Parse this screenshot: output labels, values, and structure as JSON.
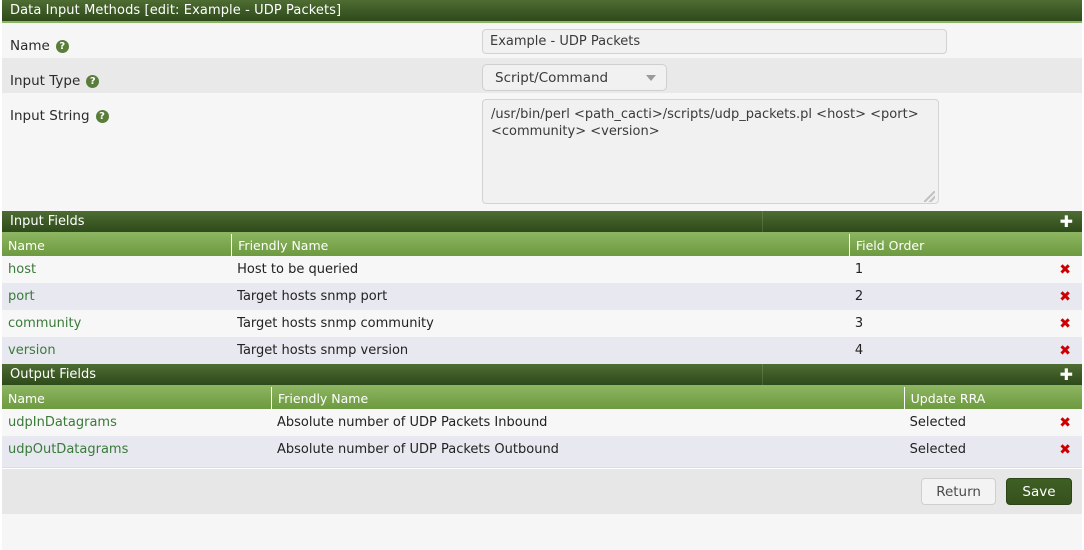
{
  "window": {
    "title": "Data Input Methods [edit: Example - UDP Packets]"
  },
  "colors": {
    "header_dark_green": "#3f5c27",
    "header_light_green": "#7aa54d",
    "accent_border": "#8ab661",
    "link_green": "#3a7a3a",
    "delete_red": "#cc0000",
    "save_button": "#35511e"
  },
  "form": {
    "name": {
      "label": "Name",
      "help_icon": "help-icon",
      "value": "Example - UDP Packets",
      "placeholder": ""
    },
    "input_type": {
      "label": "Input Type",
      "help_icon": "help-icon",
      "value": "Script/Command",
      "caret_icon": "chevron-down-icon"
    },
    "input_string": {
      "label": "Input String",
      "help_icon": "help-icon",
      "value": "/usr/bin/perl <path_cacti>/scripts/udp_packets.pl <host> <port> <community> <version>",
      "placeholder": ""
    }
  },
  "input_fields": {
    "section_title": "Input Fields",
    "add_icon": "plus-icon",
    "columns": [
      "Name",
      "Friendly Name",
      "Field Order"
    ],
    "rows": [
      {
        "name": "host",
        "friendly_name": "Host to be queried",
        "field_order": "1",
        "delete_icon": "delete-icon"
      },
      {
        "name": "port",
        "friendly_name": "Target hosts snmp port",
        "field_order": "2",
        "delete_icon": "delete-icon"
      },
      {
        "name": "community",
        "friendly_name": "Target hosts snmp community",
        "field_order": "3",
        "delete_icon": "delete-icon"
      },
      {
        "name": "version",
        "friendly_name": "Target hosts snmp version",
        "field_order": "4",
        "delete_icon": "delete-icon"
      }
    ]
  },
  "output_fields": {
    "section_title": "Output Fields",
    "add_icon": "plus-icon",
    "columns": [
      "Name",
      "Friendly Name",
      "Update RRA"
    ],
    "rows": [
      {
        "name": "udpInDatagrams",
        "friendly_name": "Absolute number of UDP Packets Inbound",
        "update_rra": "Selected",
        "delete_icon": "delete-icon"
      },
      {
        "name": "udpOutDatagrams",
        "friendly_name": "Absolute number of UDP Packets Outbound",
        "update_rra": "Selected",
        "delete_icon": "delete-icon"
      }
    ]
  },
  "footer": {
    "return_label": "Return",
    "save_label": "Save"
  }
}
